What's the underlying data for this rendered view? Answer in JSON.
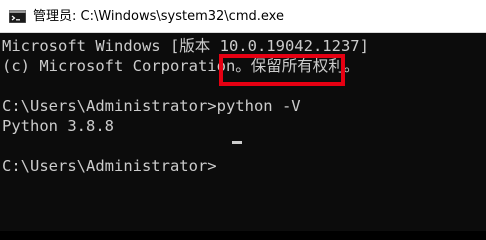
{
  "window": {
    "title": "管理员: C:\\Windows\\system32\\cmd.exe",
    "icon": "cmd-icon"
  },
  "console": {
    "lines": [
      "Microsoft Windows [版本 10.0.19042.1237]",
      "(c) Microsoft Corporation。保留所有权利。",
      "",
      "C:\\Users\\Administrator>python -V",
      "Python 3.8.8",
      "",
      "C:\\Users\\Administrator>"
    ],
    "highlight_color": "#e60012",
    "text_color": "#cccccc",
    "background": "#0c0c0c"
  }
}
